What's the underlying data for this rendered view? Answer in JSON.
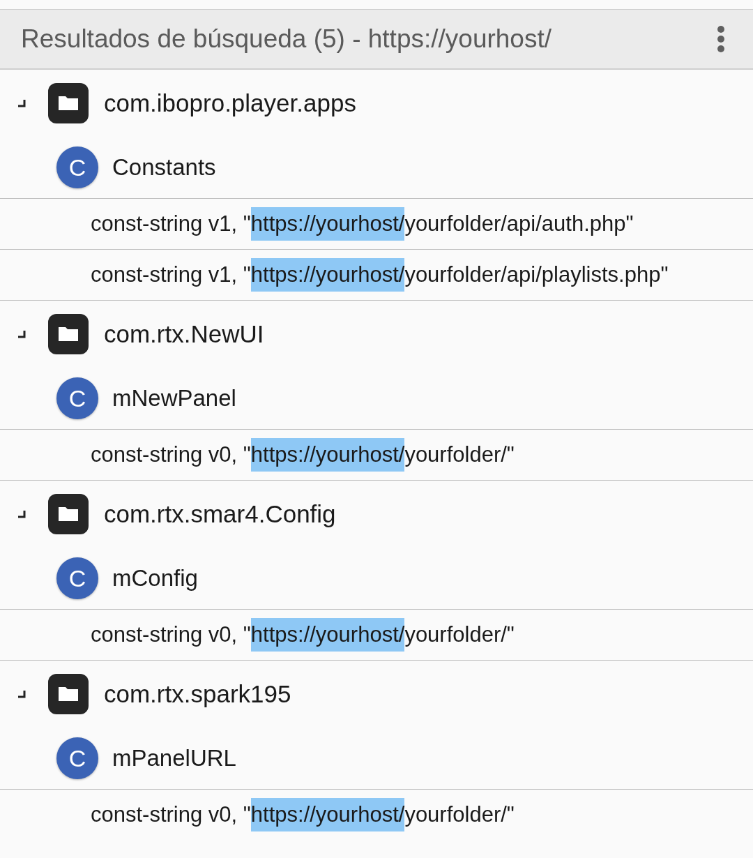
{
  "header": {
    "title": "Resultados de búsqueda (5) - https://yourhost/"
  },
  "groups": [
    {
      "package": "com.ibopro.player.apps",
      "expanded": true,
      "children": [
        {
          "badge": "C",
          "name": "Constants",
          "children": [
            {
              "prefix": "const-string v1, \"",
              "match": "https://yourhost/",
              "suffix": "yourfolder/api/auth.php\""
            },
            {
              "prefix": "const-string v1, \"",
              "match": "https://yourhost/",
              "suffix": "yourfolder/api/playlists.php\""
            }
          ]
        }
      ]
    },
    {
      "package": "com.rtx.NewUI",
      "expanded": true,
      "children": [
        {
          "badge": "C",
          "name": "mNewPanel",
          "children": [
            {
              "prefix": "const-string v0, \"",
              "match": "https://yourhost/",
              "suffix": "yourfolder/\""
            }
          ]
        }
      ]
    },
    {
      "package": "com.rtx.smar4.Config",
      "expanded": true,
      "children": [
        {
          "badge": "C",
          "name": "mConfig",
          "children": [
            {
              "prefix": "const-string v0, \"",
              "match": "https://yourhost/",
              "suffix": "yourfolder/\""
            }
          ]
        }
      ]
    },
    {
      "package": "com.rtx.spark195",
      "expanded": true,
      "children": [
        {
          "badge": "C",
          "name": "mPanelURL",
          "children": [
            {
              "prefix": "const-string v0, \"",
              "match": "https://yourhost/",
              "suffix": "yourfolder/\""
            }
          ]
        }
      ]
    }
  ]
}
